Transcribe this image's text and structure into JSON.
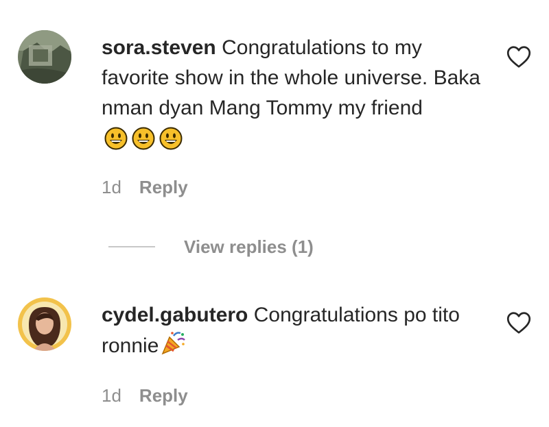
{
  "comments": [
    {
      "username": "sora.steven",
      "text": "Congratulations to my favorite show in the whole universe. Baka nman dyan Mang Tommy my friend",
      "emoji": [
        "grinning-face",
        "grinning-face",
        "grinning-face"
      ],
      "time": "1d",
      "reply_label": "Reply",
      "avatar": "landscape-photo-avatar",
      "like_icon": "heart-outline-icon"
    },
    {
      "username": "cydel.gabutero",
      "text": "Congratulations po tito ronnie",
      "emoji": [
        "party-popper"
      ],
      "time": "1d",
      "reply_label": "Reply",
      "avatar": "portrait-photo-avatar",
      "like_icon": "heart-outline-icon"
    }
  ],
  "view_replies": {
    "label": "View replies (1)"
  },
  "colors": {
    "text": "#262626",
    "secondary": "#8e8e8e",
    "divider": "#c7c7c7",
    "emoji_yellow": "#f7c02a",
    "avatar2_ring": "#f2c24b"
  }
}
